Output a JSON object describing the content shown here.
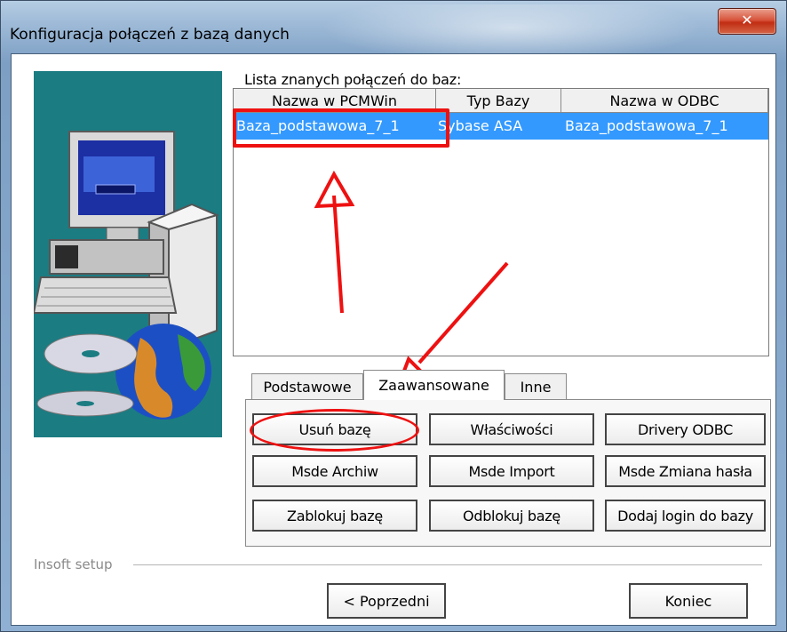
{
  "window": {
    "title": "Konfiguracja połączeń z bazą danych",
    "close_glyph": "✕"
  },
  "list": {
    "caption": "Lista znanych połączeń do baz:",
    "columns": [
      "Nazwa w PCMWin",
      "Typ Bazy",
      "Nazwa w ODBC"
    ],
    "rows": [
      {
        "name_pcmwin": "Baza_podstawowa_7_1",
        "type": "Sybase ASA",
        "name_odbc": "Baza_podstawowa_7_1",
        "selected": true
      }
    ]
  },
  "tabs": [
    {
      "label": "Podstawowe",
      "active": false
    },
    {
      "label": "Zaawansowane",
      "active": true
    },
    {
      "label": "Inne",
      "active": false
    }
  ],
  "buttons": {
    "usun_baze": "Usuń bazę",
    "wlasciwosci": "Właściwości",
    "drivery_odbc": "Drivery ODBC",
    "msde_archiw": "Msde Archiw",
    "msde_import": "Msde Import",
    "msde_zmiana_hasla": "Msde Zmiana hasła",
    "zablokuj_baze": "Zablokuj bazę",
    "odblokuj_baze": "Odblokuj bazę",
    "dodaj_login": "Dodaj login do bazy"
  },
  "footer": {
    "group_label": "Insoft setup",
    "prev_button": "< Poprzedni",
    "finish_button": "Koniec"
  },
  "colors": {
    "selection": "#3399ff",
    "annotation": "#ee1111",
    "art_background": "#1b7c82"
  },
  "icons": {
    "art": "computer-globe-cd-illustration"
  }
}
